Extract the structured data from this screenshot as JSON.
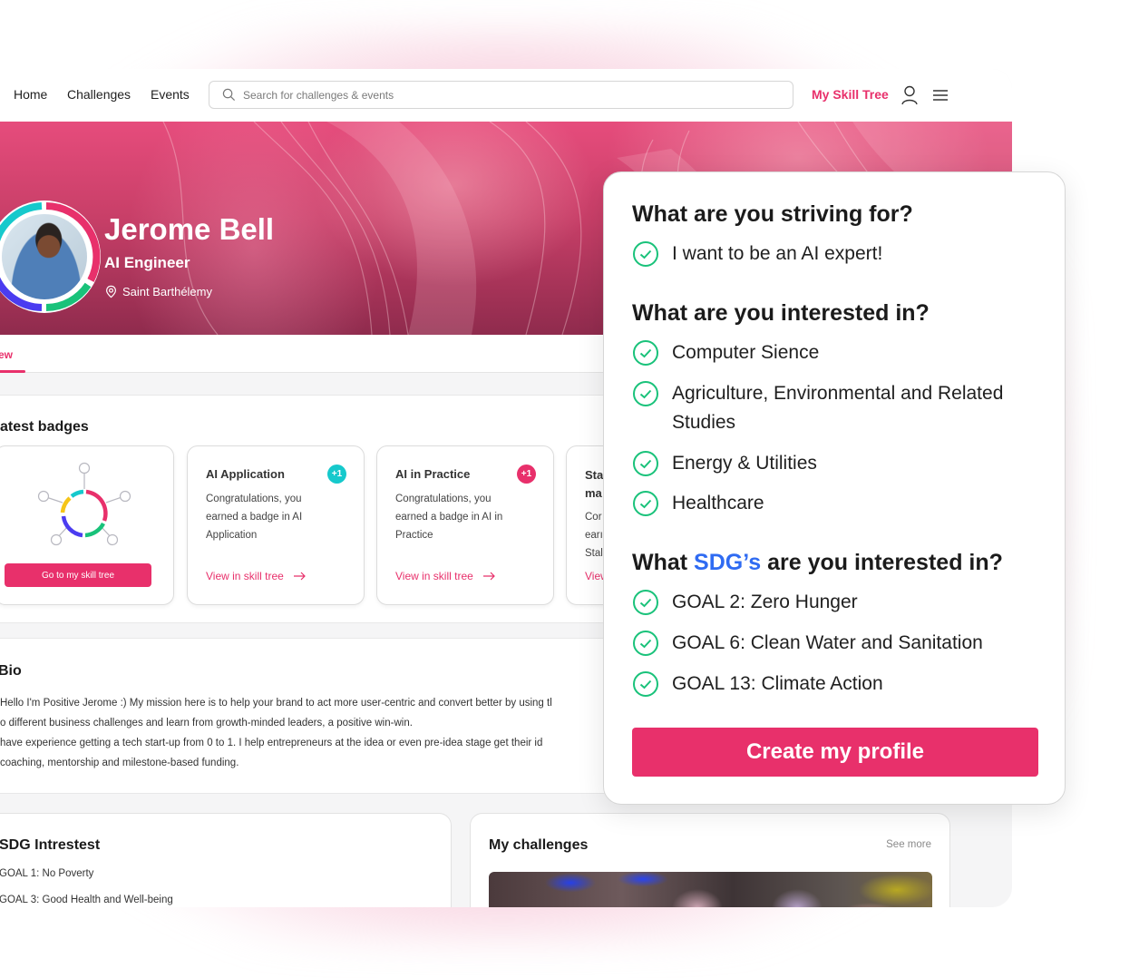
{
  "nav": {
    "links": [
      "Home",
      "Challenges",
      "Events"
    ],
    "search_placeholder": "Search for challenges & events",
    "skill_tree_label": "My Skill Tree",
    "icons": {
      "search": "search-icon",
      "user": "user-icon",
      "menu": "hamburger-menu-icon"
    }
  },
  "profile": {
    "name": "Jerome Bell",
    "role": "AI Engineer",
    "location": "Saint Barthélemy",
    "ring_colors": [
      "#e8306b",
      "#19c27a",
      "#4b3cf0",
      "#16c9cc"
    ]
  },
  "tabs": {
    "active": "view"
  },
  "badges": {
    "title": "atest badges",
    "skill_tree_button": "Go to my skill tree",
    "cards": [
      {
        "title": "AI Application",
        "plus": "+1",
        "plus_color": "#16c9cc",
        "desc": "Congratulations, you earned a badge in AI Application",
        "link": "View in skill tree"
      },
      {
        "title": "AI in Practice",
        "plus": "+1",
        "plus_color": "#e8306b",
        "desc": "Congratulations, you earned a badge in AI in Practice",
        "link": "View in skill tree"
      },
      {
        "title": "Sta ma",
        "plus": "",
        "plus_color": "",
        "desc": "Cor earı Stal",
        "link": "View"
      }
    ]
  },
  "bio": {
    "title": "Bio",
    "lines": [
      "Hello I'm Positive Jerome :) My mission here is to help your brand to act more user-centric and convert better by using tl",
      "o different business challenges and learn from growth-minded leaders, a positive win-win.",
      " have experience getting a tech start-up from 0 to 1. I help entrepreneurs at the idea or even pre-idea stage get their id",
      "coaching, mentorship and milestone-based funding."
    ]
  },
  "sdg_interest": {
    "title": "SDG Intrestest",
    "items": [
      "GOAL 1: No Poverty",
      "GOAL 3: Good Health and Well-being"
    ]
  },
  "challenges": {
    "title": "My challenges",
    "see_more": "See more"
  },
  "questionnaire": {
    "striving": {
      "heading": "What are you striving for?",
      "items": [
        "I want to be an AI expert!"
      ]
    },
    "interests": {
      "heading": "What are you interested in?",
      "items": [
        "Computer Sience",
        "Agriculture, Environmental and Related Studies",
        "Energy & Utilities",
        "Healthcare"
      ]
    },
    "sdgs": {
      "heading_prefix": "What ",
      "heading_accent": "SDG’s",
      "heading_suffix": " are you interested in?",
      "items": [
        "GOAL 2: Zero Hunger",
        "GOAL 6: Clean Water and Sanitation",
        "GOAL 13: Climate Action"
      ]
    },
    "create_button": "Create my profile",
    "check_color": "#19c27a",
    "accent_color": "#2f6bf2"
  },
  "colors": {
    "brand": "#e8306b"
  }
}
